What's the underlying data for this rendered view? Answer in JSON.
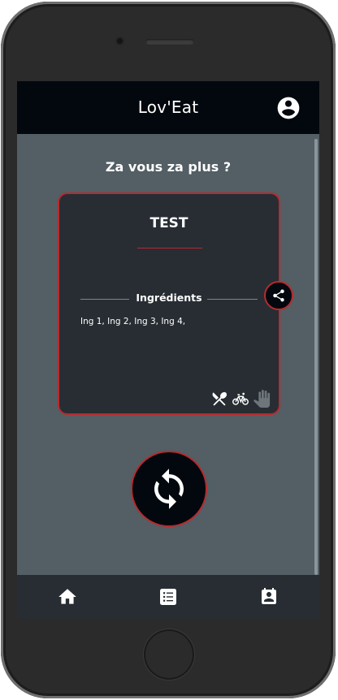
{
  "app": {
    "title": "Lov'Eat",
    "account_icon": "account-circle-icon"
  },
  "main": {
    "question": "Za vous za plus ?"
  },
  "card": {
    "title": "TEST",
    "section_label": "Ingrédients",
    "ingredients": "Ing 1, Ing 2, Ing 3, Ing 4,",
    "icons": [
      "fork-knife-icon",
      "bicycle-icon",
      "hand-icon"
    ],
    "share_icon": "share-icon"
  },
  "refresh": {
    "icon": "refresh-icon"
  },
  "bottom_nav": {
    "items": [
      "home-icon",
      "list-icon",
      "calendar-contact-icon"
    ]
  },
  "colors": {
    "accent": "#b82a2d",
    "appbar": "#02080e",
    "screen_bg": "#535e65",
    "card_bg": "#272d33",
    "disabled_icon": "#6e757b"
  }
}
